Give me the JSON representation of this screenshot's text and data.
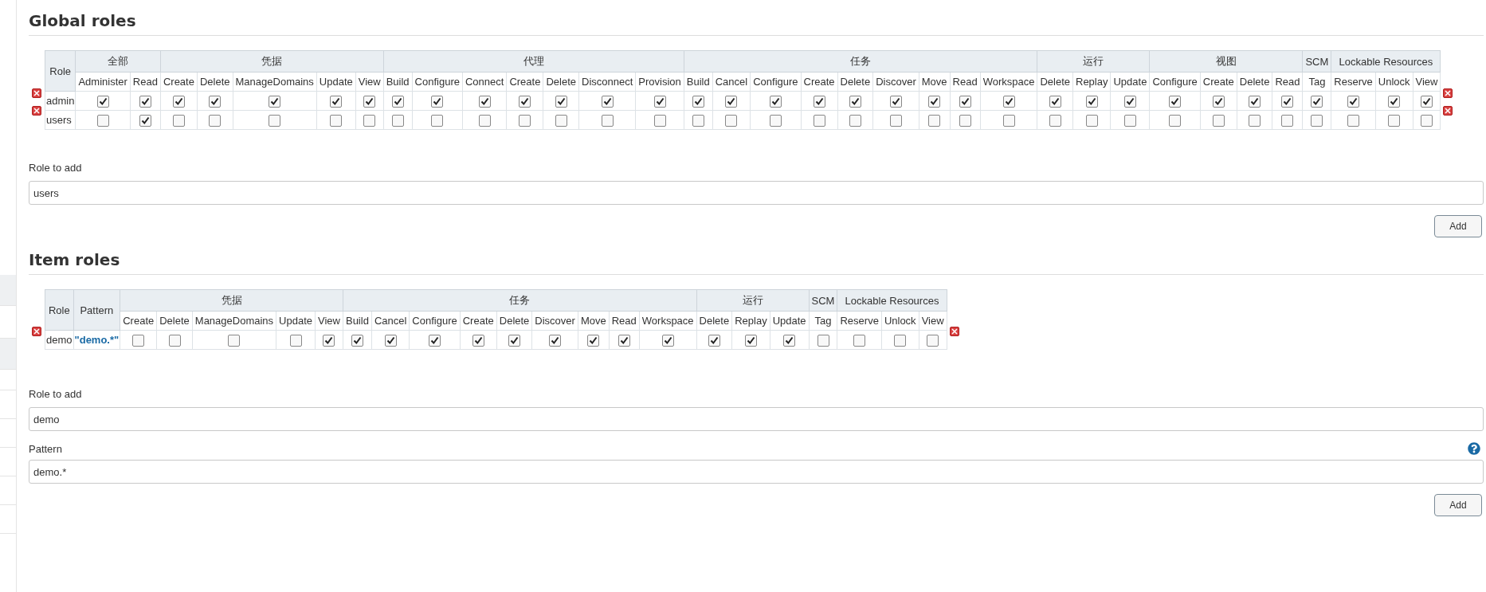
{
  "global_roles": {
    "title": "Global roles",
    "role_header": "Role",
    "groups": [
      {
        "label": "全部",
        "permissions": [
          "Administer",
          "Read"
        ]
      },
      {
        "label": "凭据",
        "permissions": [
          "Create",
          "Delete",
          "ManageDomains",
          "Update",
          "View"
        ]
      },
      {
        "label": "代理",
        "permissions": [
          "Build",
          "Configure",
          "Connect",
          "Create",
          "Delete",
          "Disconnect",
          "Provision"
        ]
      },
      {
        "label": "任务",
        "permissions": [
          "Build",
          "Cancel",
          "Configure",
          "Create",
          "Delete",
          "Discover",
          "Move",
          "Read",
          "Workspace"
        ]
      },
      {
        "label": "运行",
        "permissions": [
          "Delete",
          "Replay",
          "Update"
        ]
      },
      {
        "label": "视图",
        "permissions": [
          "Configure",
          "Create",
          "Delete",
          "Read"
        ]
      },
      {
        "label": "SCM",
        "permissions": [
          "Tag"
        ]
      },
      {
        "label": "Lockable Resources",
        "permissions": [
          "Reserve",
          "Unlock",
          "View"
        ]
      }
    ],
    "rows": [
      {
        "role": "admin",
        "checked": [
          true,
          true,
          true,
          true,
          true,
          true,
          true,
          true,
          true,
          true,
          true,
          true,
          true,
          true,
          true,
          true,
          true,
          true,
          true,
          true,
          true,
          true,
          true,
          true,
          true,
          true,
          true,
          true,
          true,
          true,
          true,
          true,
          true,
          true
        ]
      },
      {
        "role": "users",
        "checked": [
          false,
          true,
          false,
          false,
          false,
          false,
          false,
          false,
          false,
          false,
          false,
          false,
          false,
          false,
          false,
          false,
          false,
          false,
          false,
          false,
          false,
          false,
          false,
          false,
          false,
          false,
          false,
          false,
          false,
          false,
          false,
          false,
          false,
          false
        ]
      }
    ],
    "add": {
      "label": "Role to add",
      "value": "users",
      "button": "Add"
    }
  },
  "item_roles": {
    "title": "Item roles",
    "role_header": "Role",
    "pattern_header": "Pattern",
    "groups": [
      {
        "label": "凭据",
        "permissions": [
          "Create",
          "Delete",
          "ManageDomains",
          "Update",
          "View"
        ]
      },
      {
        "label": "任务",
        "permissions": [
          "Build",
          "Cancel",
          "Configure",
          "Create",
          "Delete",
          "Discover",
          "Move",
          "Read",
          "Workspace"
        ]
      },
      {
        "label": "运行",
        "permissions": [
          "Delete",
          "Replay",
          "Update"
        ]
      },
      {
        "label": "SCM",
        "permissions": [
          "Tag"
        ]
      },
      {
        "label": "Lockable Resources",
        "permissions": [
          "Reserve",
          "Unlock",
          "View"
        ]
      }
    ],
    "rows": [
      {
        "role": "demo",
        "pattern": "\"demo.*\"",
        "checked": [
          false,
          false,
          false,
          false,
          true,
          true,
          true,
          true,
          true,
          true,
          true,
          true,
          true,
          true,
          true,
          true,
          true,
          false,
          false,
          false,
          false
        ]
      }
    ],
    "add": {
      "label": "Role to add",
      "value": "demo",
      "pattern_label": "Pattern",
      "pattern_value": "demo.*",
      "button": "Add"
    }
  }
}
